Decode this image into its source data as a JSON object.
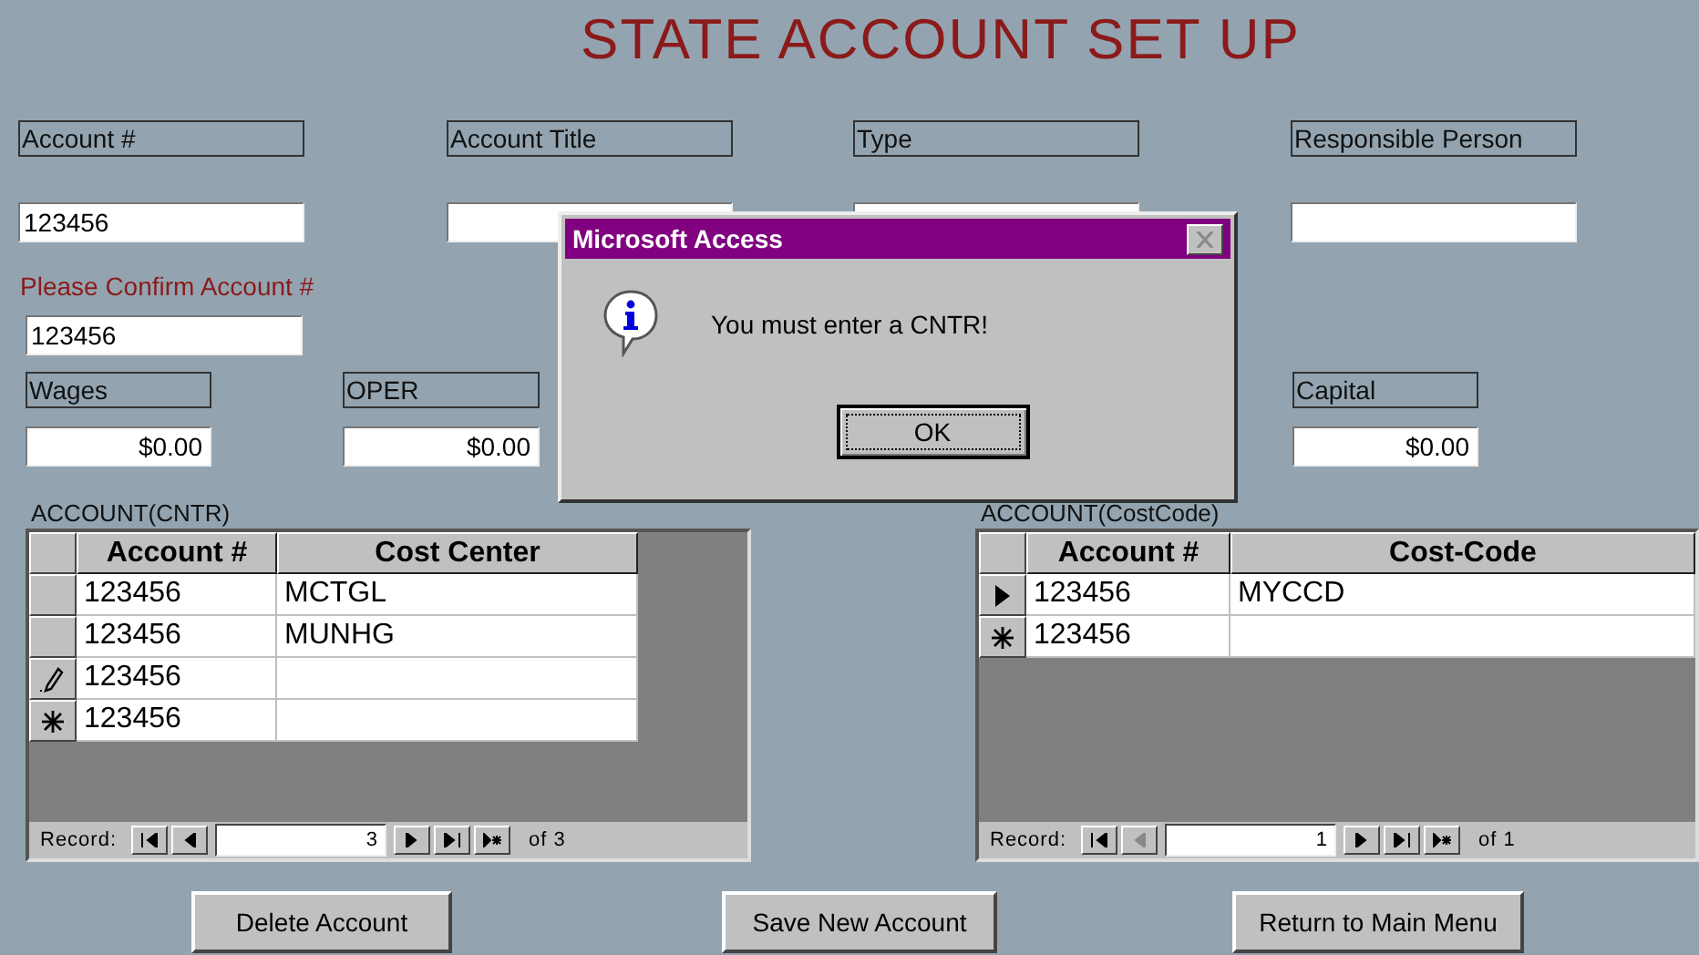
{
  "title": "STATE ACCOUNT SET UP",
  "fields": [
    {
      "label": "Account #",
      "value": "123456"
    },
    {
      "label": "Account Title"
    },
    {
      "label": "Type"
    },
    {
      "label": "Responsible Person"
    }
  ],
  "confirm": {
    "label": "Please Confirm Account #",
    "value": "123456"
  },
  "budget": [
    {
      "label": "Wages",
      "value": "$0.00"
    },
    {
      "label": "OPER",
      "value": "$0.00"
    },
    {
      "label": "Capital",
      "value": "$0.00"
    }
  ],
  "subforms": [
    {
      "caption": "ACCOUNT(CNTR)",
      "columns": [
        "Account #",
        "Cost Center"
      ],
      "rows": [
        {
          "kind": "plain",
          "cells": [
            "123456",
            "MCTGL"
          ]
        },
        {
          "kind": "plain",
          "cells": [
            "123456",
            "MUNHG"
          ]
        },
        {
          "kind": "editing",
          "cells": [
            "123456"
          ]
        },
        {
          "kind": "new",
          "cells": [
            "123456"
          ]
        }
      ],
      "record_label": "Record:",
      "record": "3",
      "total": "of 3",
      "prev_disabled": false
    },
    {
      "caption": "ACCOUNT(CostCode)",
      "columns": [
        "Account #",
        "Cost-Code"
      ],
      "rows": [
        {
          "kind": "current",
          "cells": [
            "123456",
            "MYCCD"
          ]
        },
        {
          "kind": "new",
          "cells": [
            "123456"
          ]
        }
      ],
      "record_label": "Record:",
      "record": "1",
      "total": "of 1",
      "prev_disabled": true
    }
  ],
  "buttons": [
    "Delete Account",
    "Save New Account",
    "Return to Main Menu"
  ],
  "dialog": {
    "title": "Microsoft Access",
    "message": "You must enter a CNTR!",
    "button": "OK"
  }
}
